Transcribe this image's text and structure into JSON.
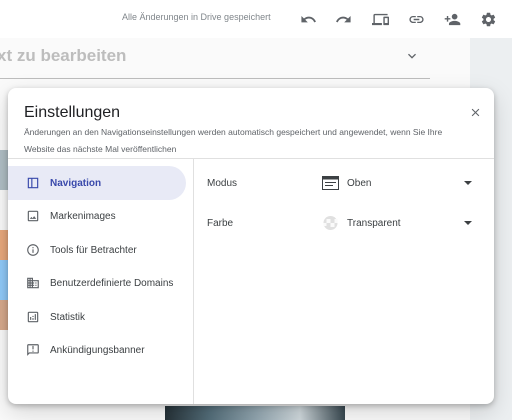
{
  "topbar": {
    "status": "Alle Änderungen in Drive gespeichert",
    "icons": [
      "undo-icon",
      "redo-icon",
      "preview-devices-icon",
      "link-icon",
      "add-person-icon",
      "gear-icon"
    ]
  },
  "editor": {
    "title_fragment": "xt zu bearbeiten"
  },
  "dialog": {
    "title": "Einstellungen",
    "subtitle": "Änderungen an den Navigationseinstellungen werden automatisch gespeichert und angewendet, wenn Sie Ihre Website das nächste Mal veröffentlichen",
    "nav": [
      {
        "label": "Navigation",
        "icon": "navigation-icon",
        "active": true
      },
      {
        "label": "Markenimages",
        "icon": "image-icon",
        "active": false
      },
      {
        "label": "Tools für Betrachter",
        "icon": "info-icon",
        "active": false
      },
      {
        "label": "Benutzerdefinierte Domains",
        "icon": "domain-icon",
        "active": false
      },
      {
        "label": "Statistik",
        "icon": "analytics-icon",
        "active": false
      },
      {
        "label": "Ankündigungsbanner",
        "icon": "announcement-icon",
        "active": false
      }
    ],
    "fields": {
      "mode": {
        "label": "Modus",
        "value": "Oben",
        "icon": "top-nav-icon"
      },
      "color": {
        "label": "Farbe",
        "value": "Transparent",
        "icon": "transparent-swatch-icon"
      }
    }
  },
  "colors": {
    "accent": "#3949ab",
    "active_bg": "#e8eaf6"
  }
}
